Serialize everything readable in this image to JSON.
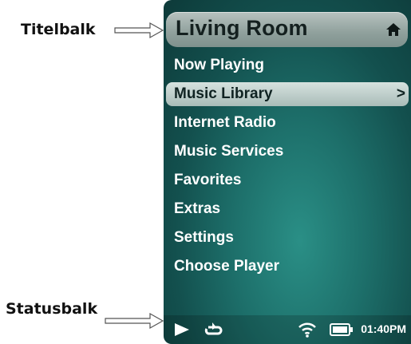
{
  "callouts": {
    "titlebar": "Titelbalk",
    "statusbar": "Statusbalk"
  },
  "screen": {
    "title": "Living Room",
    "menu": [
      {
        "label": "Now Playing"
      },
      {
        "label": "Music Library",
        "selected": true,
        "chevron": ">"
      },
      {
        "label": "Internet Radio"
      },
      {
        "label": "Music Services"
      },
      {
        "label": "Favorites"
      },
      {
        "label": "Extras"
      },
      {
        "label": "Settings"
      },
      {
        "label": "Choose Player"
      }
    ],
    "status": {
      "time": "01:40PM",
      "icons": [
        "play-icon",
        "repeat-icon",
        "wifi-icon",
        "battery-icon"
      ]
    },
    "colors": {
      "background": "#1d6f6a",
      "selected_bg": "#c3d3cf",
      "text": "#ffffff"
    }
  }
}
